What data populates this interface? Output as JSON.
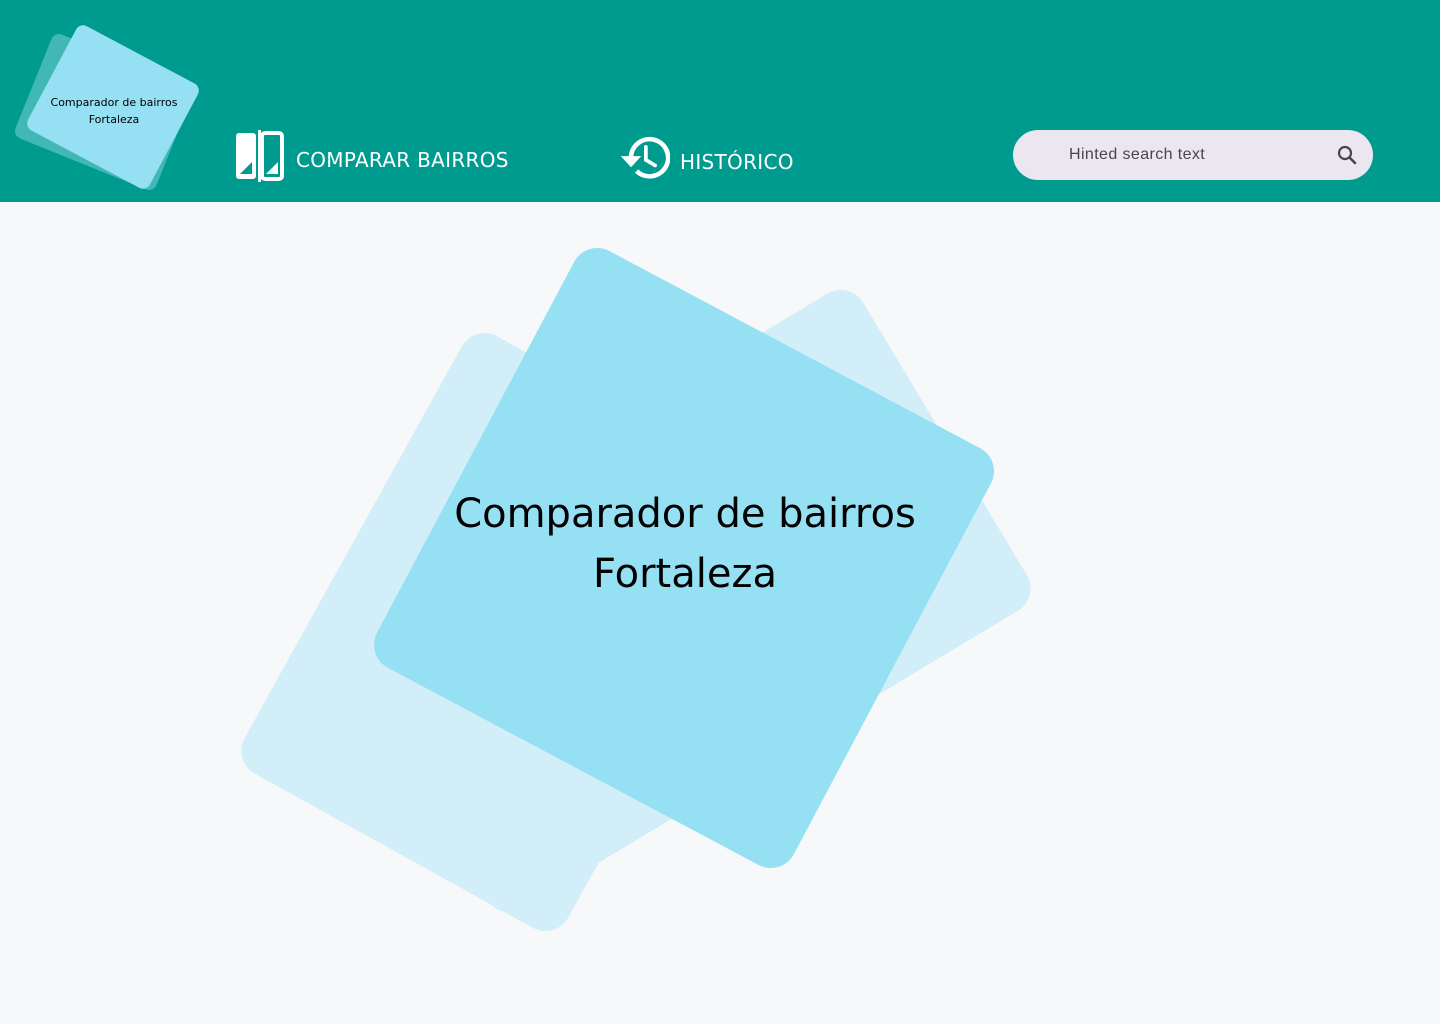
{
  "header": {
    "background_color": "#009b8f",
    "logo": {
      "line1": "Comparador de bairros",
      "line2": "Fortaleza"
    },
    "nav": [
      {
        "label": "COMPARAR BAIRROS",
        "icon": "compare-icon"
      },
      {
        "label": "HISTÓRICO",
        "icon": "history-icon"
      }
    ],
    "search": {
      "placeholder": "Hinted search text",
      "value": "",
      "icon": "search-icon"
    }
  },
  "main": {
    "title_line1": "Comparador de bairros",
    "title_line2": "Fortaleza",
    "accent_color": "#96e0f3",
    "accent_light_color": "#d2eef8"
  }
}
